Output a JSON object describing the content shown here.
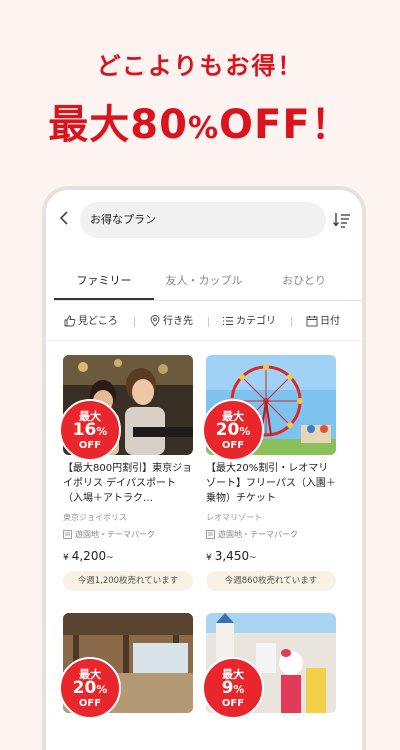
{
  "promo": {
    "headline": "どこよりもお得！",
    "discount_prefix": "最大",
    "discount_value": "80",
    "discount_pct": "%",
    "discount_suffix": "OFF！"
  },
  "search": {
    "placeholder": "お得なプラン"
  },
  "tabs": [
    {
      "label": "ファミリー",
      "active": true
    },
    {
      "label": "友人・カップル",
      "active": false
    },
    {
      "label": "おひとり",
      "active": false
    }
  ],
  "filters": [
    {
      "label": "見どころ",
      "icon": "thumbs-up-icon"
    },
    {
      "label": "行き先",
      "icon": "map-pin-icon"
    },
    {
      "label": "カテゴリ",
      "icon": "list-icon"
    },
    {
      "label": "日付",
      "icon": "calendar-icon"
    }
  ],
  "cards": [
    {
      "badge_prefix": "最大",
      "badge_value": "16",
      "badge_pct": "%",
      "badge_off": "OFF",
      "title": "【最大800円割引】東京ジョイポリス デイパスポート（入場＋アトラク…",
      "brand": "東京ジョイポリス",
      "category": "遊園地・テーマパーク",
      "price_yen": "¥",
      "price": "4,200",
      "price_suffix": "~",
      "sold": "今週1,200枚売れています"
    },
    {
      "badge_prefix": "最大",
      "badge_value": "20",
      "badge_pct": "%",
      "badge_off": "OFF",
      "title": "【最大20%割引・レオマリゾート】フリーパス（入園＋乗物）チケット",
      "brand": "レオマリゾート",
      "category": "遊園地・テーマパーク",
      "price_yen": "¥",
      "price": "3,450",
      "price_suffix": "~",
      "sold": "今週860枚売れています"
    },
    {
      "badge_prefix": "最大",
      "badge_value": "20",
      "badge_pct": "%",
      "badge_off": "OFF"
    },
    {
      "badge_prefix": "最大",
      "badge_value": "9",
      "badge_pct": "%",
      "badge_off": "OFF"
    }
  ],
  "colors": {
    "accent": "#e8262b",
    "headline": "#d9141e",
    "background": "#fdf3f1"
  }
}
